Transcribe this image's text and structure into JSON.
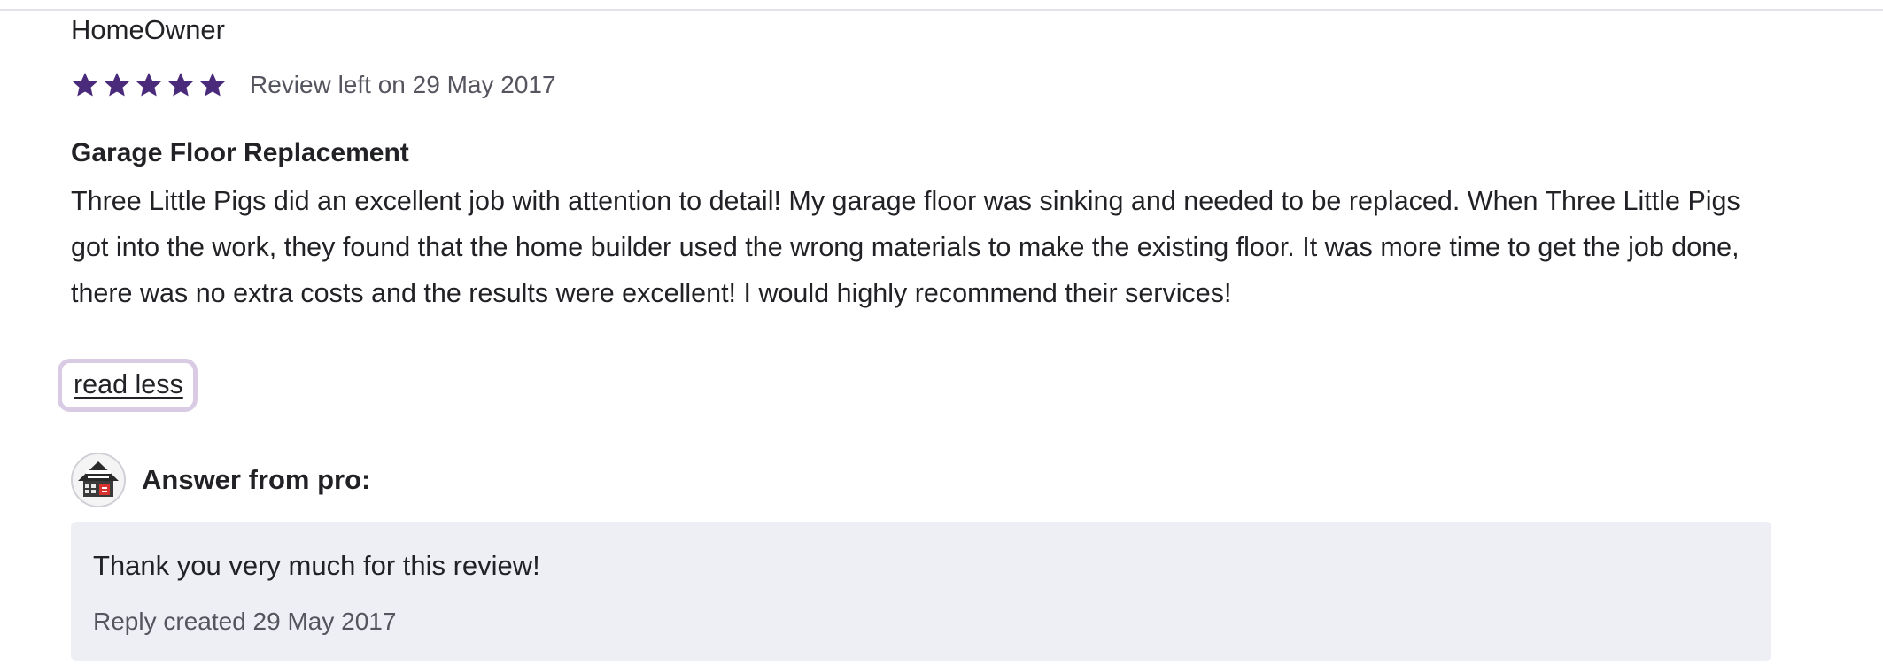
{
  "review": {
    "author": "HomeOwner",
    "rating": 5,
    "rating_max": 5,
    "star_color": "#4a2b7b",
    "date_text": "Review left on 29 May 2017",
    "title": "Garage Floor Replacement",
    "body": "Three Little Pigs did an excellent job with attention to detail! My garage floor was sinking and needed to be replaced. When Three Little Pigs got into the work, they found that the home builder used the wrong materials to make the existing floor. It was more time to get the job done, there was no extra costs and the results were excellent! I would highly recommend their services!",
    "toggle_label": "read less"
  },
  "answer": {
    "avatar_icon": "pro-logo-avatar",
    "label": "Answer from pro:",
    "text": "Thank you very much for this review!",
    "date_text": "Reply created 29 May 2017"
  }
}
